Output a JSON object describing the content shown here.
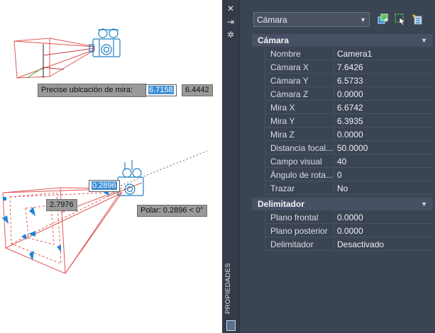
{
  "canvas": {
    "tooltip_prompt": "Precise ubicación de mira:",
    "input_x": "6.7158",
    "input_y": "6.4442",
    "dim_length": "0.2896",
    "dim_distance": "2.7976",
    "polar_tip": "Polar: 0.2896 < 0°"
  },
  "palette": {
    "title": "PROPIEDADES",
    "strip_icons": [
      "close-icon",
      "auto-hide-icon",
      "settings-icon"
    ],
    "object_select": "Cámara",
    "toolbar_icons": [
      "toggle-pickadd-icon",
      "select-objects-icon",
      "quick-select-icon"
    ],
    "sections": [
      {
        "title": "Cámara",
        "rows": [
          {
            "name": "Nombre",
            "value": "Camera1"
          },
          {
            "name": "Cámara X",
            "value": "7.6426"
          },
          {
            "name": "Cámara Y",
            "value": "6.5733"
          },
          {
            "name": "Cámara Z",
            "value": "0.0000"
          },
          {
            "name": "Mira X",
            "value": "6.6742"
          },
          {
            "name": "Mira Y",
            "value": "6.3935"
          },
          {
            "name": "Mira Z",
            "value": "0.0000"
          },
          {
            "name": "Distancia focal...",
            "value": "50.0000"
          },
          {
            "name": "Campo visual",
            "value": "40"
          },
          {
            "name": "Ángulo de rota...",
            "value": "0"
          },
          {
            "name": "Trazar",
            "value": "No"
          }
        ]
      },
      {
        "title": "Delimitador",
        "rows": [
          {
            "name": "Plano frontal",
            "value": "0.0000"
          },
          {
            "name": "Plano posterior",
            "value": "0.0000"
          },
          {
            "name": "Delimitador",
            "value": "Desactivado"
          }
        ]
      }
    ]
  },
  "colors": {
    "palette_bg": "#3b4453",
    "section_bg": "#475064",
    "selection": "#3d8fd6",
    "camera_glyph": "#1e7fc4",
    "frustum": "#e05555",
    "grip": "#1a84d8"
  }
}
